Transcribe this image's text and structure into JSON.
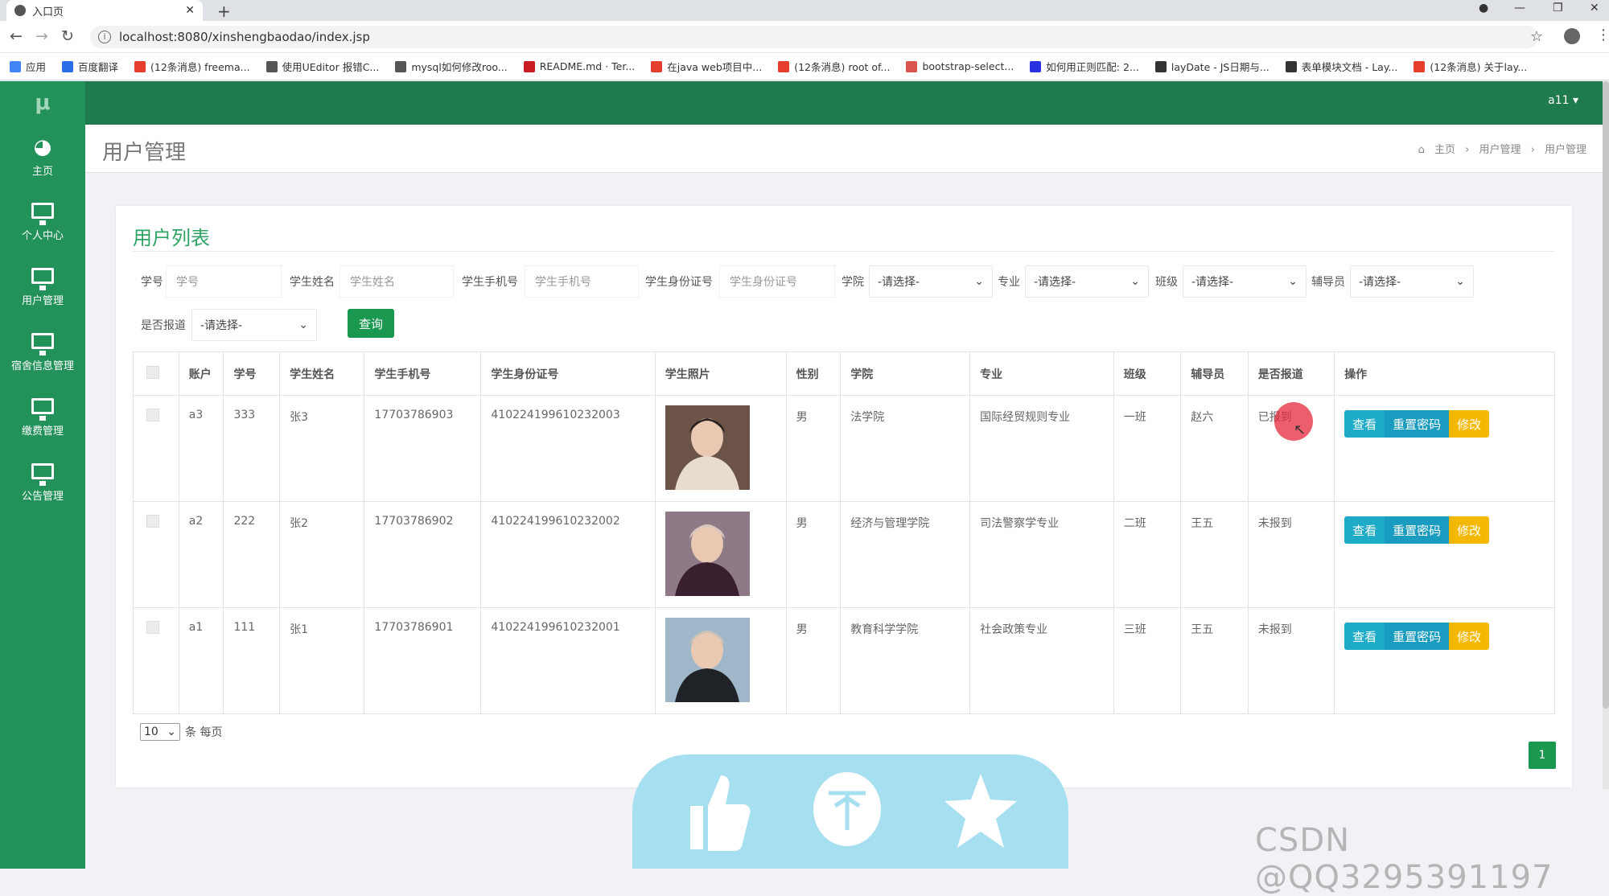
{
  "browser": {
    "tab_title": "入口页",
    "url": "localhost:8080/xinshengbaodao/index.jsp",
    "bookmarks": [
      {
        "label": "应用",
        "icon": "apps-grid-icon",
        "color": "#4285f4"
      },
      {
        "label": "百度翻译",
        "icon": "baidu-translate-icon",
        "color": "#2b6de5"
      },
      {
        "label": "(12条消息) freema...",
        "icon": "csdn-icon",
        "color": "#e53e2d"
      },
      {
        "label": "使用UEditor 报错C...",
        "icon": "link-icon",
        "color": "#555555"
      },
      {
        "label": "mysql如何修改roo...",
        "icon": "link-icon",
        "color": "#555555"
      },
      {
        "label": "README.md · Ter...",
        "icon": "gitee-icon",
        "color": "#c71d23"
      },
      {
        "label": "在java web项目中...",
        "icon": "csdn-icon",
        "color": "#e53e2d"
      },
      {
        "label": "(12条消息) root of...",
        "icon": "csdn-icon",
        "color": "#e53e2d"
      },
      {
        "label": "bootstrap-select...",
        "icon": "page-icon",
        "color": "#d9534f"
      },
      {
        "label": "如何用正则匹配: 2...",
        "icon": "baidu-icon",
        "color": "#2932e1"
      },
      {
        "label": "layDate - JS日期与...",
        "icon": "layui-icon",
        "color": "#333333"
      },
      {
        "label": "表单模块文档 - Lay...",
        "icon": "layui-icon",
        "color": "#333333"
      },
      {
        "label": "(12条消息) 关于lay...",
        "icon": "csdn-icon",
        "color": "#e53e2d"
      }
    ]
  },
  "app": {
    "logo": "μ",
    "user": "a11 ▾",
    "sidebar": [
      {
        "label": "主页",
        "icon": "dashboard-icon"
      },
      {
        "label": "个人中心",
        "icon": "monitor-icon"
      },
      {
        "label": "用户管理",
        "icon": "monitor-icon"
      },
      {
        "label": "宿舍信息管理",
        "icon": "monitor-icon"
      },
      {
        "label": "缴费管理",
        "icon": "monitor-icon"
      },
      {
        "label": "公告管理",
        "icon": "monitor-icon"
      }
    ],
    "page_title": "用户管理",
    "breadcrumb": [
      "主页",
      "用户管理",
      "用户管理"
    ]
  },
  "list": {
    "title": "用户列表",
    "filters": {
      "student_no": {
        "label": "学号",
        "placeholder": "学号"
      },
      "student_name": {
        "label": "学生姓名",
        "placeholder": "学生姓名"
      },
      "phone": {
        "label": "学生手机号",
        "placeholder": "学生手机号"
      },
      "id_card": {
        "label": "学生身份证号",
        "placeholder": "学生身份证号"
      },
      "college": {
        "label": "学院",
        "value": "-请选择-"
      },
      "major": {
        "label": "专业",
        "value": "-请选择-"
      },
      "class": {
        "label": "班级",
        "value": "-请选择-"
      },
      "counselor": {
        "label": "辅导员",
        "value": "-请选择-"
      },
      "reported": {
        "label": "是否报道",
        "value": "-请选择-"
      },
      "query_button": "查询"
    },
    "columns": [
      "账户",
      "学号",
      "学生姓名",
      "学生手机号",
      "学生身份证号",
      "学生照片",
      "性别",
      "学院",
      "专业",
      "班级",
      "辅导员",
      "是否报道",
      "操作"
    ],
    "rows": [
      {
        "account": "a3",
        "student_no": "333",
        "name": "张3",
        "phone": "17703786903",
        "id_card": "410224199610232003",
        "gender": "男",
        "college": "法学院",
        "major": "国际经贸规则专业",
        "class": "一班",
        "counselor": "赵六",
        "reported": "已报到"
      },
      {
        "account": "a2",
        "student_no": "222",
        "name": "张2",
        "phone": "17703786902",
        "id_card": "410224199610232002",
        "gender": "男",
        "college": "经济与管理学院",
        "major": "司法警察学专业",
        "class": "二班",
        "counselor": "王五",
        "reported": "未报到"
      },
      {
        "account": "a1",
        "student_no": "111",
        "name": "张1",
        "phone": "17703786901",
        "id_card": "410224199610232001",
        "gender": "男",
        "college": "教育科学学院",
        "major": "社会政策专业",
        "class": "三班",
        "counselor": "王五",
        "reported": "未报到"
      }
    ],
    "actions": {
      "view": "查看",
      "reset": "重置密码",
      "edit": "修改"
    },
    "page_size": "10",
    "page_size_suffix": "条 每页",
    "current_page": "1"
  },
  "overlay": {
    "watermark": "CSDN @QQ3295391197",
    "float_icons": [
      "thumbs-up-icon",
      "coin-icon",
      "star-icon"
    ]
  },
  "colors": {
    "sidebar": "#23925a",
    "topbar": "#1f7b4d",
    "accent": "#2ea363",
    "view": "#1eabc7",
    "edit": "#f5b800"
  }
}
